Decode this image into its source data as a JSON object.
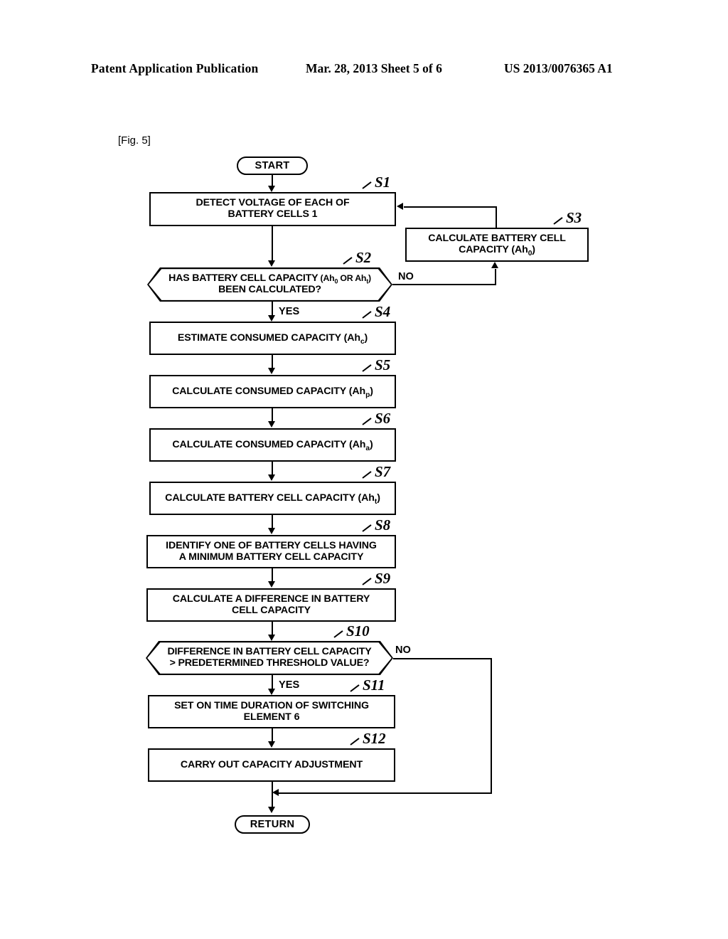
{
  "header": {
    "publication": "Patent Application Publication",
    "date_sheet": "Mar. 28, 2013  Sheet 5 of 6",
    "doc_number": "US 2013/0076365 A1"
  },
  "figure": {
    "tag": "[Fig. 5]"
  },
  "flowchart": {
    "type": "flowchart",
    "nodes": [
      {
        "id": "start",
        "shape": "terminator",
        "label": "START"
      },
      {
        "id": "S1",
        "shape": "process",
        "step": "S1",
        "label": "DETECT VOLTAGE OF EACH OF BATTERY CELLS 1",
        "line1": "DETECT VOLTAGE OF EACH OF",
        "line2": "BATTERY CELLS 1"
      },
      {
        "id": "S2",
        "shape": "decision",
        "step": "S2",
        "label": "HAS BATTERY CELL CAPACITY (Ah0 OR Aht) BEEN CALCULATED?",
        "line1": "HAS BATTERY CELL CAPACITY",
        "line1_paren": "(Ah0 OR Aht)",
        "line2": "BEEN CALCULATED?"
      },
      {
        "id": "S3",
        "shape": "process",
        "step": "S3",
        "label": "CALCULATE BATTERY CELL CAPACITY (Ah0)",
        "line1": "CALCULATE BATTERY CELL",
        "line2": "CAPACITY (Ah0)"
      },
      {
        "id": "S4",
        "shape": "process",
        "step": "S4",
        "label": "ESTIMATE CONSUMED CAPACITY (Ahc)",
        "line1": "ESTIMATE CONSUMED CAPACITY (Ahc)"
      },
      {
        "id": "S5",
        "shape": "process",
        "step": "S5",
        "label": "CALCULATE CONSUMED CAPACITY (Ahp)",
        "line1": "CALCULATE CONSUMED CAPACITY (Ahp)"
      },
      {
        "id": "S6",
        "shape": "process",
        "step": "S6",
        "label": "CALCULATE CONSUMED CAPACITY (Aha)",
        "line1": "CALCULATE CONSUMED CAPACITY (Aha)"
      },
      {
        "id": "S7",
        "shape": "process",
        "step": "S7",
        "label": "CALCULATE BATTERY CELL CAPACITY (Aht)",
        "line1": "CALCULATE BATTERY CELL CAPACITY (Aht)"
      },
      {
        "id": "S8",
        "shape": "process",
        "step": "S8",
        "label": "IDENTIFY ONE OF BATTERY CELLS HAVING A MINIMUM BATTERY CELL CAPACITY",
        "line1": "IDENTIFY ONE OF BATTERY CELLS HAVING",
        "line2": "A MINIMUM BATTERY CELL CAPACITY"
      },
      {
        "id": "S9",
        "shape": "process",
        "step": "S9",
        "label": "CALCULATE A DIFFERENCE IN BATTERY CELL CAPACITY",
        "line1": "CALCULATE A DIFFERENCE IN BATTERY",
        "line2": "CELL CAPACITY"
      },
      {
        "id": "S10",
        "shape": "decision",
        "step": "S10",
        "label": "DIFFERENCE IN BATTERY CELL CAPACITY > PREDETERMINED THRESHOLD VALUE?",
        "line1": "DIFFERENCE IN BATTERY CELL CAPACITY",
        "line2": "> PREDETERMINED THRESHOLD VALUE?"
      },
      {
        "id": "S11",
        "shape": "process",
        "step": "S11",
        "label": "SET ON TIME DURATION OF SWITCHING ELEMENT 6",
        "line1": "SET ON TIME DURATION OF SWITCHING",
        "line2": "ELEMENT 6"
      },
      {
        "id": "S12",
        "shape": "process",
        "step": "S12",
        "label": "CARRY OUT CAPACITY ADJUSTMENT",
        "line1": "CARRY OUT CAPACITY ADJUSTMENT"
      },
      {
        "id": "return",
        "shape": "terminator",
        "label": "RETURN"
      }
    ],
    "branch_labels": {
      "s2_no": "NO",
      "s2_yes": "YES",
      "s10_no": "NO",
      "s10_yes": "YES"
    },
    "step_labels": {
      "S1": "S1",
      "S2": "S2",
      "S3": "S3",
      "S4": "S4",
      "S5": "S5",
      "S6": "S6",
      "S7": "S7",
      "S8": "S8",
      "S9": "S9",
      "S10": "S10",
      "S11": "S11",
      "S12": "S12"
    },
    "edges": [
      {
        "from": "start",
        "to": "S1"
      },
      {
        "from": "S1",
        "to": "S2"
      },
      {
        "from": "S2",
        "to": "S3",
        "label": "NO"
      },
      {
        "from": "S2",
        "to": "S4",
        "label": "YES"
      },
      {
        "from": "S3",
        "to": "S1"
      },
      {
        "from": "S4",
        "to": "S5"
      },
      {
        "from": "S5",
        "to": "S6"
      },
      {
        "from": "S6",
        "to": "S7"
      },
      {
        "from": "S7",
        "to": "S8"
      },
      {
        "from": "S8",
        "to": "S9"
      },
      {
        "from": "S9",
        "to": "S10"
      },
      {
        "from": "S10",
        "to": "S11",
        "label": "YES"
      },
      {
        "from": "S10",
        "to": "return",
        "label": "NO"
      },
      {
        "from": "S11",
        "to": "S12"
      },
      {
        "from": "S12",
        "to": "return"
      }
    ]
  }
}
